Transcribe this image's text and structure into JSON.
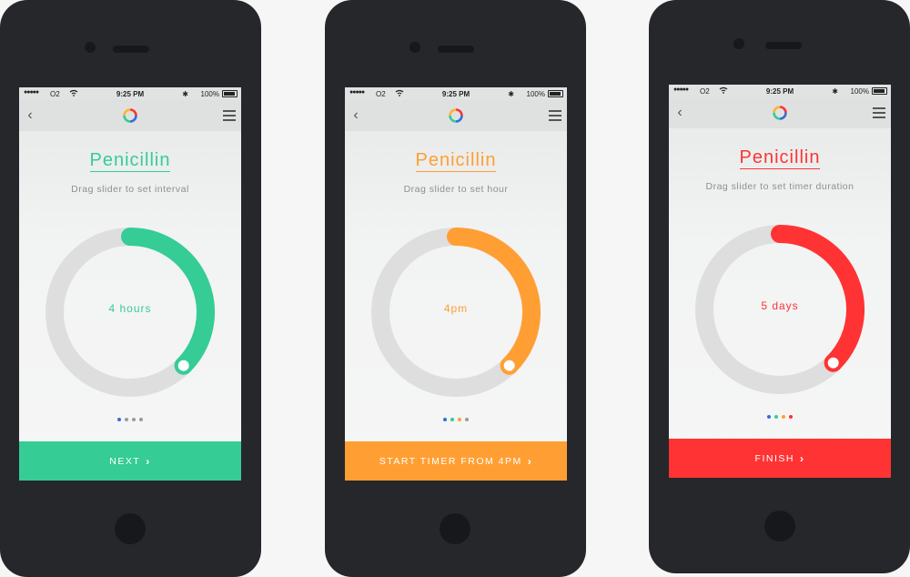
{
  "status_bar": {
    "signal": "●●●●●",
    "carrier": "O2",
    "time": "9:25 PM",
    "bluetooth": "✱",
    "battery": "100%"
  },
  "icons": {
    "back": "chevron-left-icon",
    "logo": "rainbow-ring-logo",
    "menu": "hamburger-menu-icon",
    "cta_chevron": "›"
  },
  "screens": [
    {
      "title": "Penicillin",
      "instruction": "Drag slider to set interval",
      "dial_value": "4 hours",
      "accent": "#35cc96",
      "slider_fraction": 0.375,
      "page_index": 0,
      "page_dot_colors": [
        "#2f6fd8",
        "#9a9a9a",
        "#9a9a9a",
        "#9a9a9a"
      ],
      "button_label": "NEXT"
    },
    {
      "title": "Penicillin",
      "instruction": "Drag slider to set hour",
      "dial_value": "4pm",
      "accent": "#ff9f33",
      "slider_fraction": 0.375,
      "page_index": 1,
      "page_dot_colors": [
        "#2f6fd8",
        "#35cc96",
        "#ff9f33",
        "#9a9a9a"
      ],
      "button_label": "START TIMER FROM 4PM"
    },
    {
      "title": "Penicillin",
      "instruction": "Drag slider to set timer duration",
      "dial_value": "5 days",
      "accent": "#ff3333",
      "slider_fraction": 0.375,
      "page_index": 2,
      "page_dot_colors": [
        "#2f6fd8",
        "#35cc96",
        "#ff9f33",
        "#ff3333"
      ],
      "button_label": "FINISH"
    }
  ]
}
